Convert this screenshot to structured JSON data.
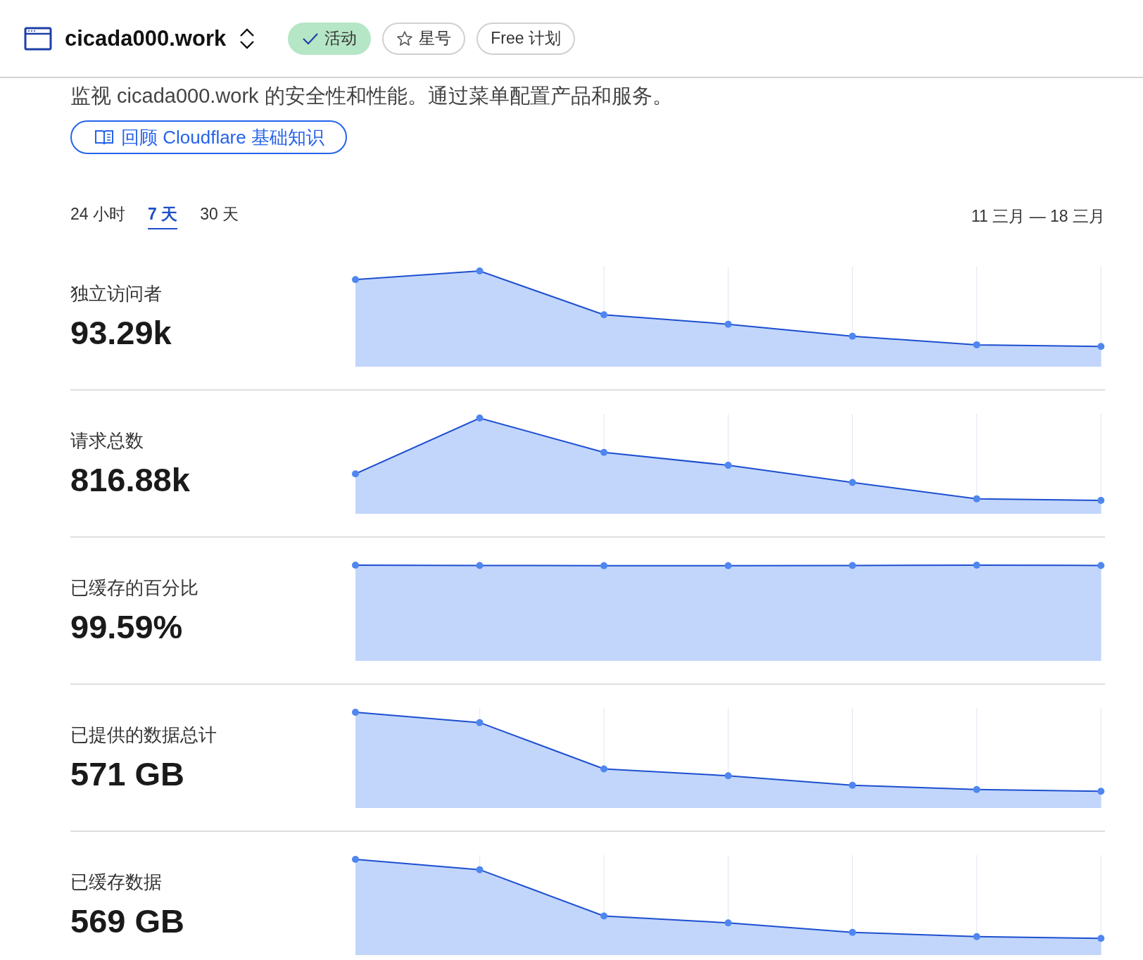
{
  "header": {
    "title": "cicada000.work",
    "badges": [
      {
        "kind": "status",
        "label": "活动"
      },
      {
        "kind": "star",
        "label": "星号"
      },
      {
        "kind": "plain",
        "label": "Free 计划"
      }
    ]
  },
  "description": "监视 cicada000.work 的安全性和性能。通过菜单配置产品和服务。",
  "guide_link": "回顾 Cloudflare 基础知识",
  "range_tabs": [
    {
      "label": "24 小时",
      "selected": false
    },
    {
      "label": "7 天",
      "selected": true
    },
    {
      "label": "30 天",
      "selected": false
    }
  ],
  "date_range": "11 三月 — 18 三月",
  "metrics": [
    {
      "label": "独立访问者",
      "value": "93.29k"
    },
    {
      "label": "请求总数",
      "value": "816.88k"
    },
    {
      "label": "已缓存的百分比",
      "value": "99.59%"
    },
    {
      "label": "已提供的数据总计",
      "value": "571 GB"
    },
    {
      "label": "已缓存数据",
      "value": "569 GB"
    }
  ]
}
